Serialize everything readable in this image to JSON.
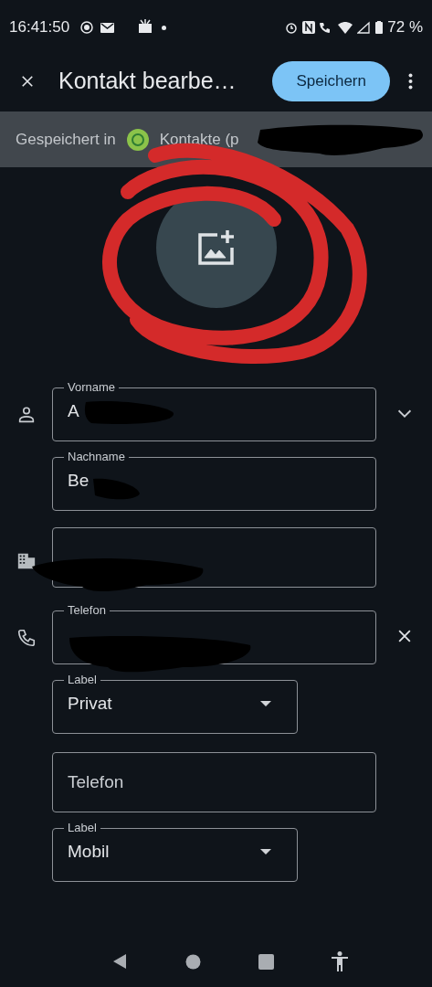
{
  "status_bar": {
    "time": "16:41:50",
    "battery": "72 %"
  },
  "toolbar": {
    "title": "Kontakt bearbe…",
    "save_button": "Speichern"
  },
  "saved_in": {
    "label": "Gespeichert in",
    "account": "Kontakte (p"
  },
  "fields": [
    {
      "kind": "text",
      "label": "Vorname",
      "value": "A"
    },
    {
      "kind": "text",
      "label": "Nachname",
      "value": "Be"
    },
    {
      "kind": "text"
    },
    {
      "kind": "text",
      "label": "Telefon"
    },
    {
      "kind": "select",
      "label": "Label",
      "value": "Privat"
    },
    {
      "kind": "text",
      "placeholder": "Telefon"
    },
    {
      "kind": "select",
      "label": "Label",
      "value": "Mobil"
    }
  ]
}
